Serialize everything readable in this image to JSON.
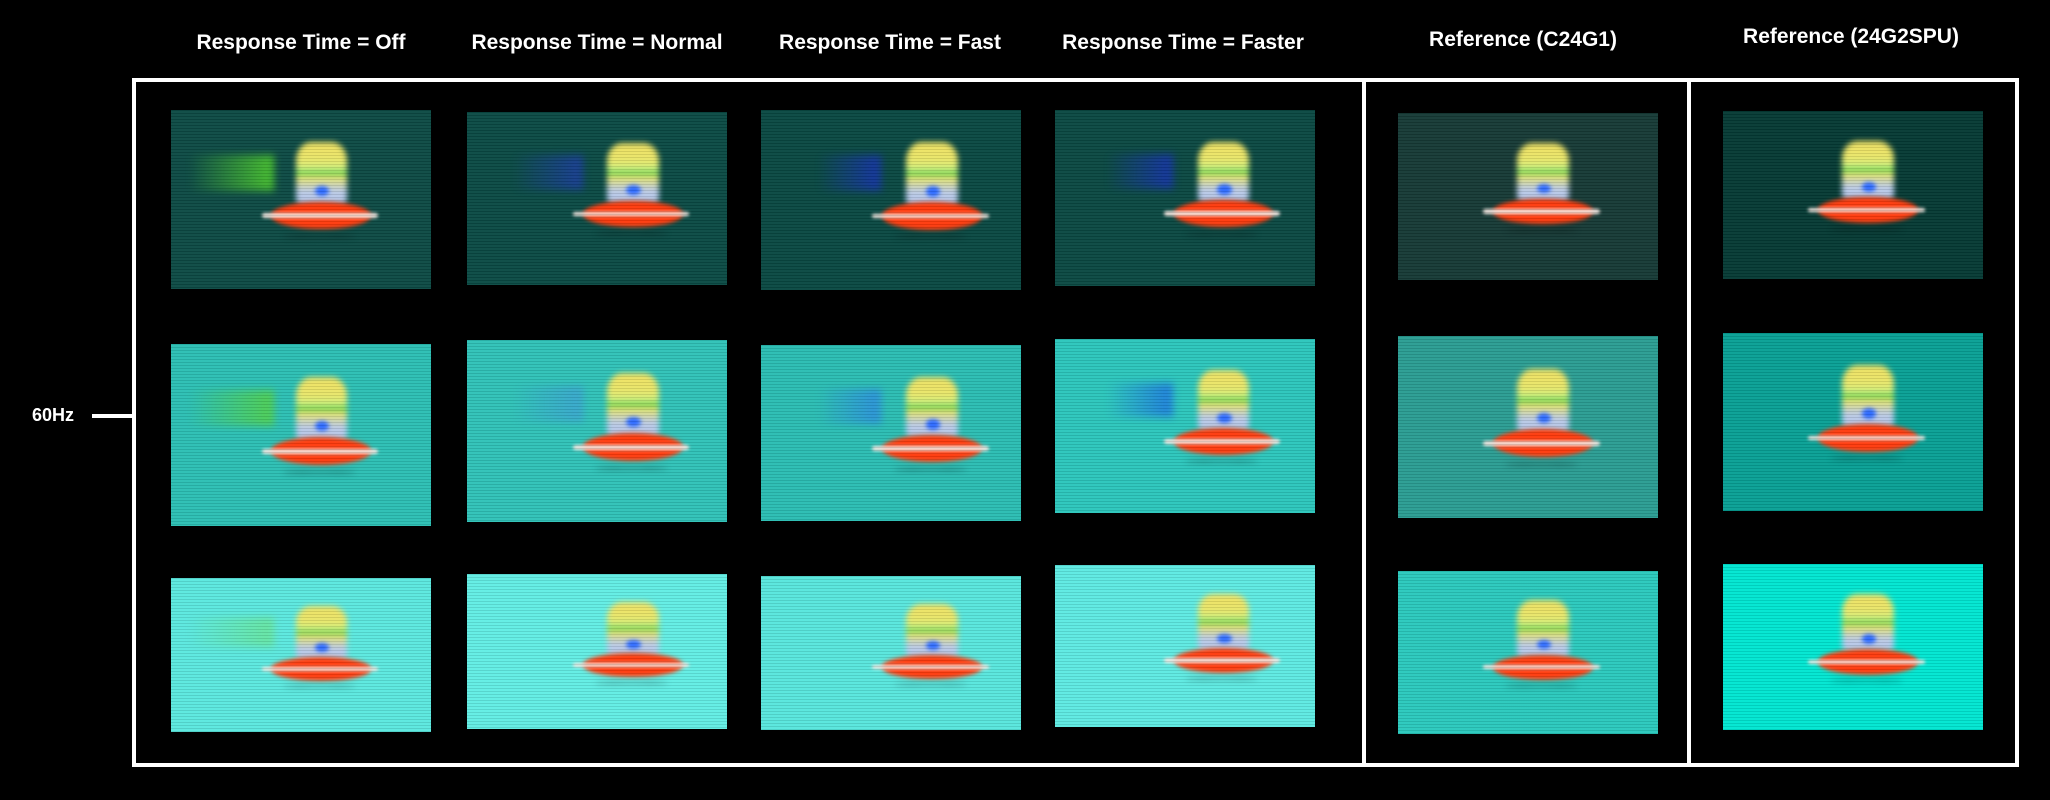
{
  "columns": [
    {
      "label": "Response Time = Off",
      "setting": "Off"
    },
    {
      "label": "Response Time = Normal",
      "setting": "Normal"
    },
    {
      "label": "Response Time = Fast",
      "setting": "Fast"
    },
    {
      "label": "Response Time = Faster",
      "setting": "Faster"
    },
    {
      "label": "Reference (C24G1)",
      "setting": "Reference C24G1"
    },
    {
      "label": "Reference (24G2SPU)",
      "setting": "Reference 24G2SPU"
    }
  ],
  "row_label": "60Hz",
  "rows": [
    {
      "name": "dark-background",
      "bg_colors": [
        "#0c4a44",
        "#0a4a44",
        "#094842",
        "#0a4842",
        "#163a36",
        "#053a34"
      ],
      "trail_colors": [
        "#4fd02a",
        "#1a3aa0",
        "#1530b0",
        "#1530b0",
        "",
        ""
      ]
    },
    {
      "name": "medium-background",
      "bg_colors": [
        "#2bbfb4",
        "#2fc2b8",
        "#2abdb3",
        "#2bc6bc",
        "#2a9d93",
        "#08a095"
      ],
      "trail_colors": [
        "#54d040",
        "#3aa0d0",
        "#2a88e0",
        "#1a70e0",
        "",
        ""
      ]
    },
    {
      "name": "light-background",
      "bg_colors": [
        "#5be8df",
        "#62ede4",
        "#58e6dd",
        "#5eeae2",
        "#2ac9bd",
        "#00e6d2"
      ],
      "trail_colors": [
        "#70e060",
        "",
        "",
        "",
        "",
        ""
      ]
    }
  ],
  "colors": {
    "saucer": "#ff3a0c",
    "dome": "#e8e66a",
    "eye": "#2a68ff",
    "frame": "#ffffff"
  }
}
